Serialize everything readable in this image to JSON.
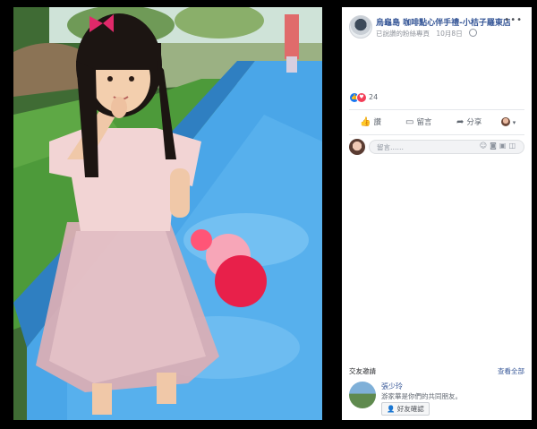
{
  "post": {
    "page_name": "烏龜島 咖啡點心伴手禮-小桔子羅東店",
    "more_icon": "more-dots-icon",
    "audience_note": "已說讚的粉絲專頁",
    "date": "10月8日",
    "privacy_icon": "globe-icon"
  },
  "reactions": {
    "icons": [
      "like-reaction-icon",
      "love-reaction-icon"
    ],
    "count": "24"
  },
  "actions": {
    "like": "讚",
    "comment": "留言",
    "share": "分享"
  },
  "comment_box": {
    "placeholder": "留言……",
    "icons": [
      "emoji-icon",
      "camera-icon",
      "gif-icon",
      "sticker-icon"
    ]
  },
  "friend_requests": {
    "title": "交友邀請",
    "see_all": "查看全部",
    "name": "張少玲",
    "mutual": "游家華是你們的共同朋友。",
    "button": "好友確認"
  },
  "colors": {
    "link": "#385898",
    "like": "#1877f2",
    "love": "#f33e58"
  }
}
